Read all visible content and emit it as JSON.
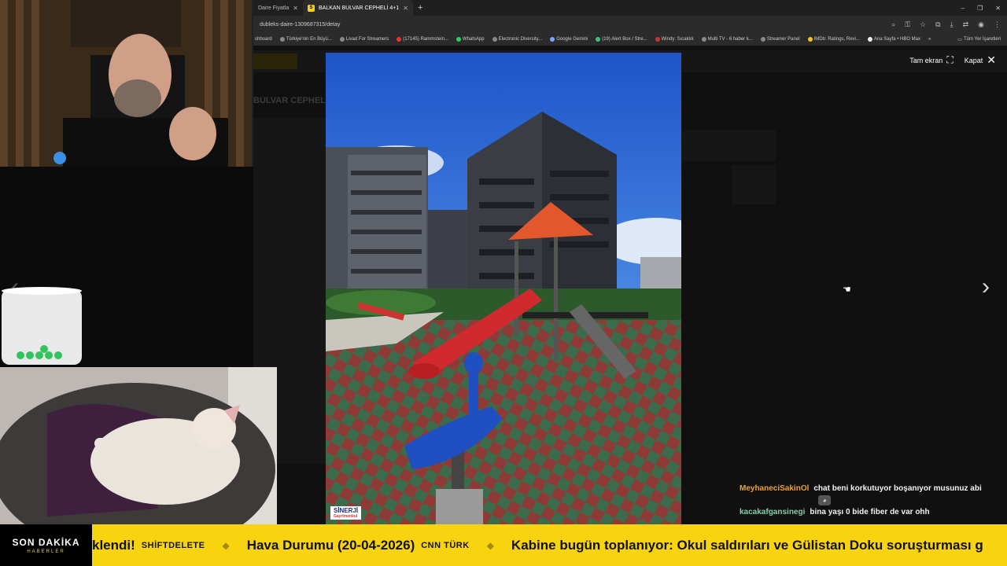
{
  "browser": {
    "tabs": [
      {
        "label": "Daire Fiyatla",
        "active": false
      },
      {
        "label": "BALKAN BULVAR CEPHELİ 4+1",
        "active": true
      }
    ],
    "url": "dubleks-daire-1309687315/detay",
    "bookmarks": [
      "shboard",
      "Türkiye'nin En Büyü...",
      "Livad For Streamers",
      "(17145) Rammstein...",
      "WhatsApp",
      "Electronic Diversity...",
      "Google Gemini",
      "(19) Alert Box / Stre...",
      "Windy: Sıcaklık",
      "Multi TV - 6 haber k...",
      "Streamer Panel",
      "IMDb: Ratings, Revi...",
      "Ana Sayfa • HBO Max"
    ],
    "bookmarks_overflow": "»",
    "bookmarks_folder": "Tüm Yer İşaretleri"
  },
  "page": {
    "listing_title": "BULVAR CEPHELİ"
  },
  "lightbox": {
    "fullscreen_label": "Tam ekran",
    "close_label": "Kapat",
    "watermark": "SİNERJİ",
    "watermark_sub": "Gayrimenkul"
  },
  "chat": {
    "messages": [
      {
        "user": "MeyhaneciSakinOl",
        "text": "chat beni korkutuyor boşanıyor musunuz abi",
        "color": "#e8a33c"
      },
      {
        "user": "kacakafgansinegi",
        "text": "bina yaşı 0 bide fiber de var ohh",
        "color": "#7fd1a8"
      }
    ]
  },
  "ticker": {
    "brand_title": "SON DAKİKA",
    "brand_sub": "HABERLER",
    "items": [
      {
        "headline": "klendi!",
        "source": "SHİFTDELETE"
      },
      {
        "headline": "Hava Durumu (20-04-2026)",
        "source": "CNN TÜRK"
      },
      {
        "headline": "Kabine bugün toplanıyor: Okul saldırıları ve Gülistan Doku soruşturması g",
        "source": ""
      }
    ]
  },
  "colors": {
    "ticker_bg": "#f7d40f",
    "brand_bg": "#000000"
  }
}
